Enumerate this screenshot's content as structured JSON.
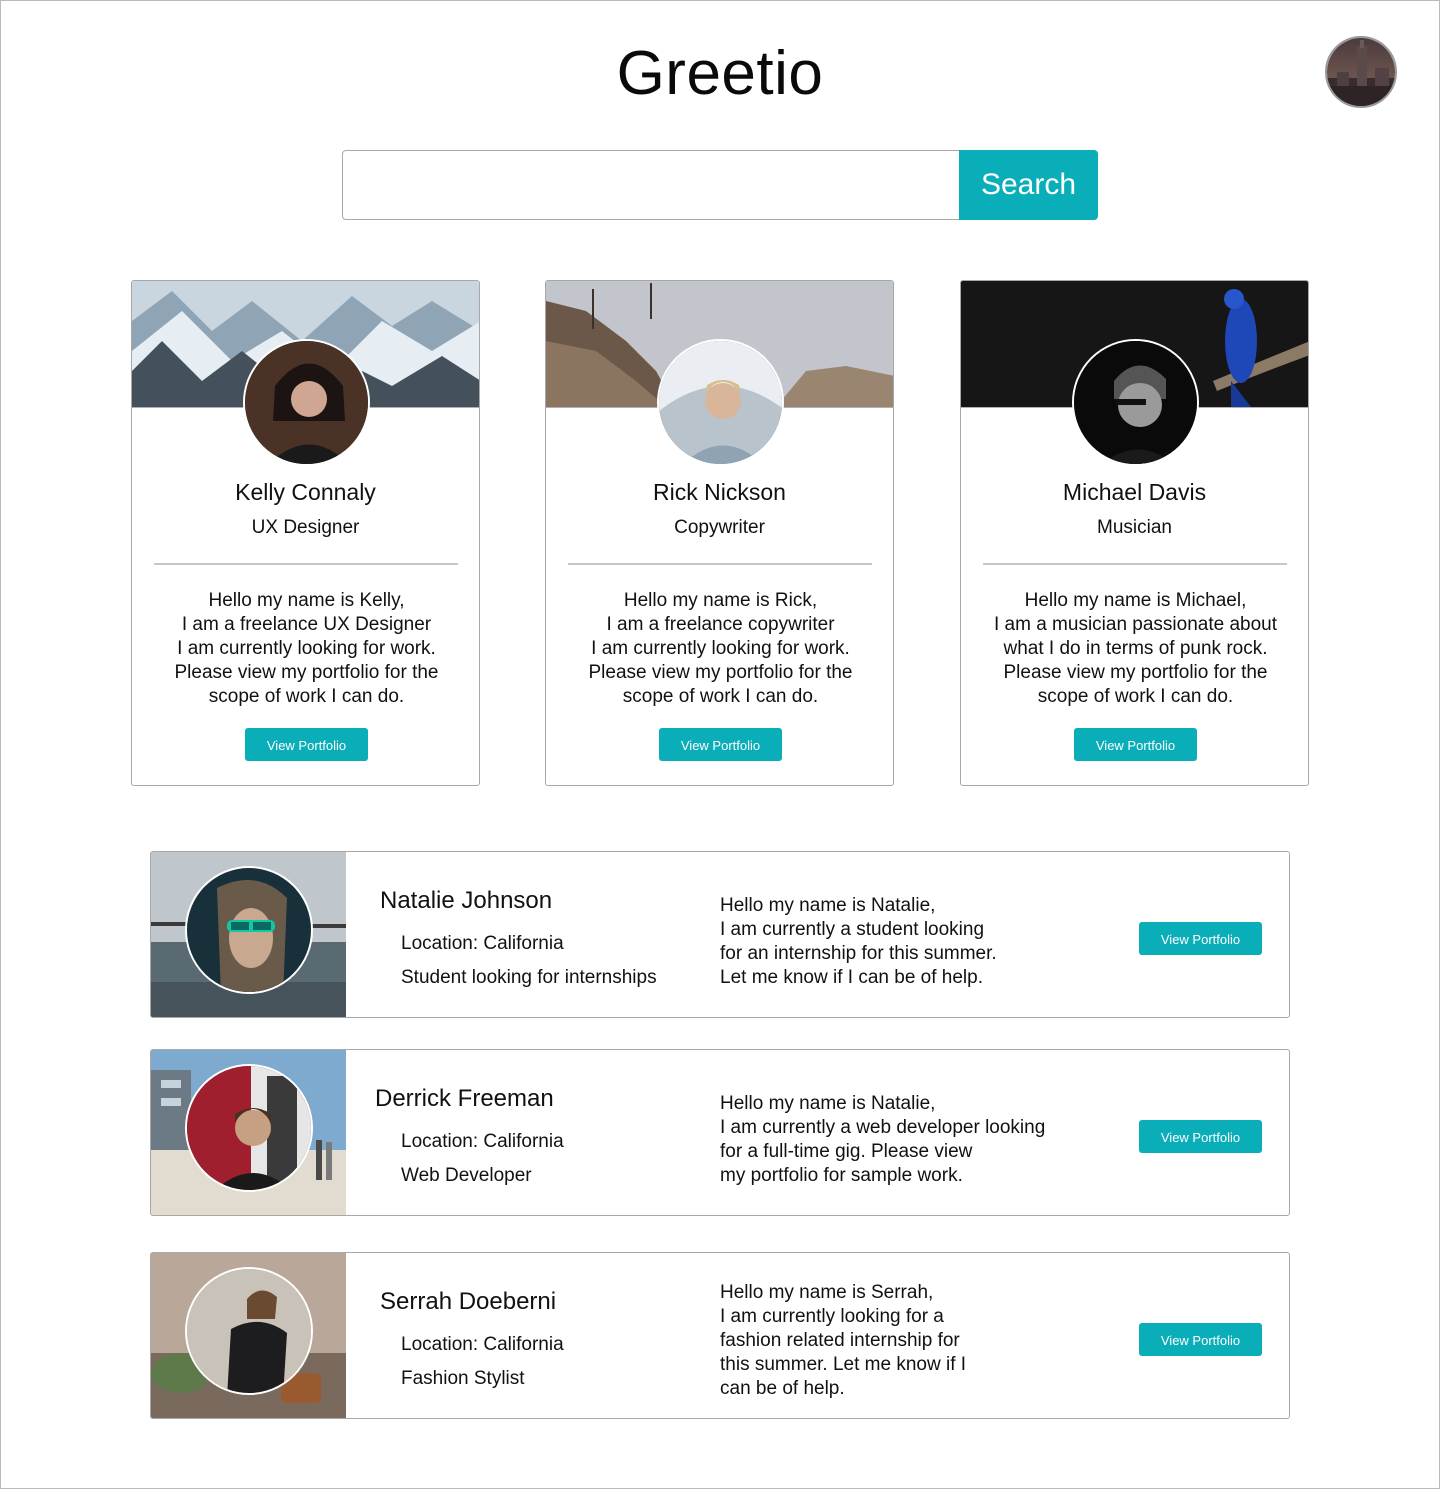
{
  "app": {
    "title": "Greetio"
  },
  "header": {
    "profile_avatar": "user-avatar-icon"
  },
  "search": {
    "value": "",
    "placeholder": "",
    "button_label": "Search"
  },
  "colors": {
    "accent": "#0aaeb8",
    "border": "#a8a8a8"
  },
  "featured": [
    {
      "name": "Kelly Connaly",
      "role": "UX Designer",
      "bio": [
        "Hello my name is Kelly,",
        "I am a freelance UX Designer",
        "I am currently looking for work.",
        "Please view my portfolio for the",
        "scope of work I can do."
      ],
      "button_label": "View Portfolio"
    },
    {
      "name": "Rick Nickson",
      "role": "Copywriter",
      "bio": [
        "Hello my name is Rick,",
        "I am a freelance copywriter",
        "I am currently looking for work.",
        "Please view my portfolio for the",
        "scope of work I can do."
      ],
      "button_label": "View Portfolio"
    },
    {
      "name": "Michael Davis",
      "role": "Musician",
      "bio": [
        "Hello my name is Michael,",
        "I am a musician passionate about",
        "what I do in terms of punk rock.",
        "Please view my portfolio for the",
        "scope of work I can do."
      ],
      "button_label": "View Portfolio"
    }
  ],
  "list": [
    {
      "name": "Natalie Johnson",
      "location": "Location: California",
      "title": "Student looking for internships",
      "bio": [
        "Hello my name is Natalie,",
        "I am currently a student looking",
        "for an internship for this summer.",
        "Let me know if I can be of help."
      ],
      "button_label": "View Portfolio"
    },
    {
      "name": "Derrick Freeman",
      "location": "Location: California",
      "title": "Web Developer",
      "bio": [
        "Hello my name is Natalie,",
        "I am currently a web developer looking",
        "for a full-time gig. Please view",
        "my portfolio for sample work."
      ],
      "button_label": "View Portfolio"
    },
    {
      "name": "Serrah Doeberni",
      "location": "Location: California",
      "title": "Fashion Stylist",
      "bio": [
        "Hello my name is Serrah,",
        "I am currently looking for a",
        "fashion related internship for",
        "this summer. Let me know if I",
        "can be of help."
      ],
      "button_label": "View Portfolio"
    }
  ]
}
